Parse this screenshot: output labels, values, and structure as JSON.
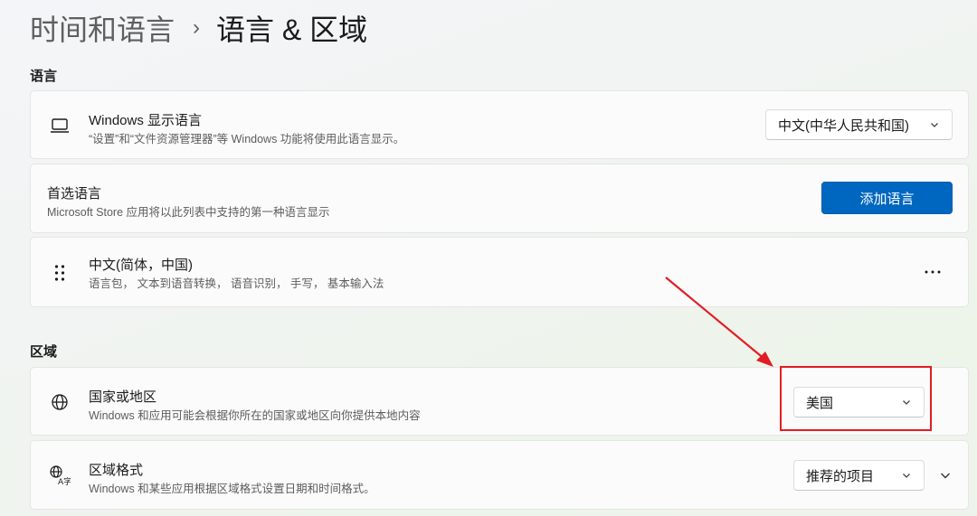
{
  "breadcrumb": {
    "parent": "时间和语言",
    "separator": "›",
    "current": "语言 & 区域"
  },
  "language_section": {
    "label": "语言",
    "display_language": {
      "icon": "laptop-icon",
      "title": "Windows 显示语言",
      "description": "“设置”和“文件资源管理器”等 Windows 功能将使用此语言显示。",
      "selected": "中文(中华人民共和国)"
    },
    "preferred": {
      "title": "首选语言",
      "description": "Microsoft Store 应用将以此列表中支持的第一种语言显示",
      "button_label": "添加语言"
    },
    "language_item": {
      "icon": "drag-handle-icon",
      "title": "中文(简体，中国)",
      "description": "语言包， 文本到语音转换， 语音识别， 手写， 基本输入法",
      "more_label": "···"
    }
  },
  "region_section": {
    "label": "区域",
    "country": {
      "icon": "globe-icon",
      "title": "国家或地区",
      "description": "Windows 和应用可能会根据你所在的国家或地区向你提供本地内容",
      "selected": "美国"
    },
    "format": {
      "icon": "regional-format-icon",
      "title": "区域格式",
      "description": "Windows 和某些应用根据区域格式设置日期和时间格式。",
      "selected": "推荐的项目"
    }
  },
  "colors": {
    "accent": "#0067c0",
    "annotation_red": "#e31c23"
  }
}
